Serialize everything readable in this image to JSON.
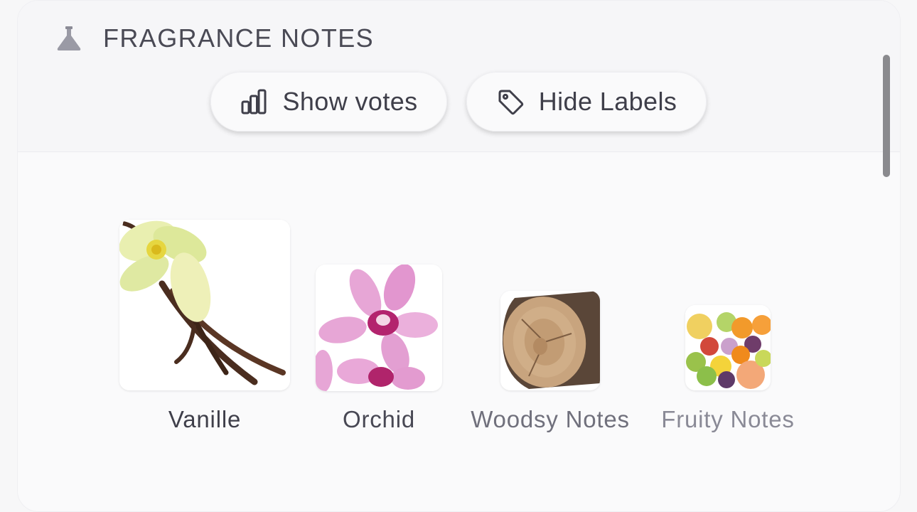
{
  "section": {
    "title": "FRAGRANCE NOTES",
    "icon": "flask-icon"
  },
  "toolbar": {
    "show_votes_label": "Show votes",
    "show_votes_icon": "bar-chart-icon",
    "hide_labels_label": "Hide Labels",
    "hide_labels_icon": "tag-icon"
  },
  "notes": [
    {
      "name": "Vanille",
      "image": "vanilla-image"
    },
    {
      "name": "Orchid",
      "image": "orchid-image"
    },
    {
      "name": "Woodsy Notes",
      "image": "wood-log-image"
    },
    {
      "name": "Fruity Notes",
      "image": "fruits-image"
    }
  ],
  "colors": {
    "text_strong": "#3f3f4a",
    "text_mid": "#5a5a66",
    "text_muted": "#8a8a96"
  }
}
